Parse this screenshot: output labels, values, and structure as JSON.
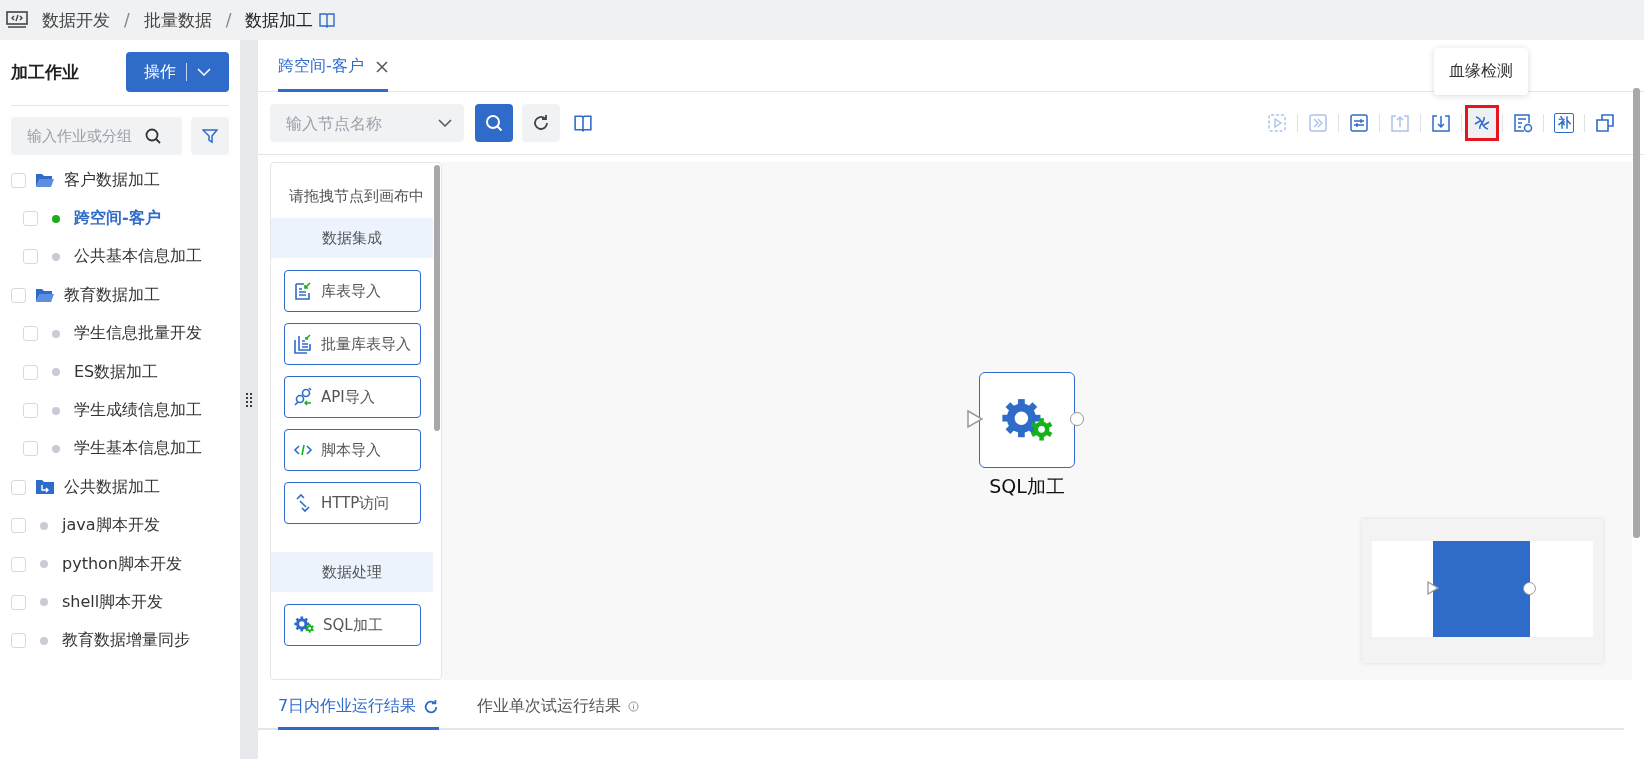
{
  "breadcrumb": {
    "items": [
      "数据开发",
      "批量数据",
      "数据加工"
    ],
    "separators": [
      "/",
      "/"
    ]
  },
  "sidebar": {
    "title": "加工作业",
    "action_button": "操作",
    "search": {
      "placeholder": "输入作业或分组"
    },
    "items": [
      {
        "kind": "folder",
        "label": "客户数据加工",
        "checked": false,
        "selected": false,
        "expanded": true,
        "children": [
          {
            "kind": "job",
            "label": "跨空间-客户",
            "checked": false,
            "selected": true,
            "color": "#1aad19"
          },
          {
            "kind": "job",
            "label": "公共基本信息加工",
            "checked": false,
            "selected": false,
            "color": "#c8ccd4"
          }
        ]
      },
      {
        "kind": "folder",
        "label": "教育数据加工",
        "checked": false,
        "selected": false,
        "expanded": true,
        "children": [
          {
            "kind": "job",
            "label": "学生信息批量开发",
            "checked": false,
            "selected": false,
            "color": "#c8ccd4"
          },
          {
            "kind": "job",
            "label": "ES数据加工",
            "checked": false,
            "selected": false,
            "color": "#c8ccd4"
          },
          {
            "kind": "job",
            "label": "学生成绩信息加工",
            "checked": false,
            "selected": false,
            "color": "#c8ccd4"
          },
          {
            "kind": "job",
            "label": "学生基本信息加工",
            "checked": false,
            "selected": false,
            "color": "#c8ccd4"
          }
        ]
      },
      {
        "kind": "folder",
        "label": "公共数据加工",
        "checked": false,
        "selected": false,
        "expanded": false
      },
      {
        "kind": "job",
        "label": "java脚本开发",
        "checked": false,
        "selected": false,
        "color": "#c8ccd4"
      },
      {
        "kind": "job",
        "label": "python脚本开发",
        "checked": false,
        "selected": false,
        "color": "#c8ccd4"
      },
      {
        "kind": "job",
        "label": "shell脚本开发",
        "checked": false,
        "selected": false,
        "color": "#c8ccd4"
      },
      {
        "kind": "job",
        "label": "教育数据增量同步",
        "checked": false,
        "selected": false,
        "color": "#c8ccd4"
      }
    ]
  },
  "tabs": [
    {
      "label": "跨空间-客户",
      "selected": true
    }
  ],
  "toolbar": {
    "node_search": {
      "placeholder": "输入节点名称"
    },
    "tools": [
      {
        "kind": "run-box",
        "disabled": true,
        "selected": false
      },
      {
        "kind": "fast-forward",
        "disabled": true,
        "selected": false
      },
      {
        "kind": "sliders",
        "disabled": false,
        "selected": false
      },
      {
        "kind": "upload",
        "disabled": true,
        "selected": false
      },
      {
        "kind": "download",
        "disabled": false,
        "selected": false
      },
      {
        "kind": "helix",
        "disabled": false,
        "selected": true,
        "tooltip": "血缘检测"
      },
      {
        "kind": "doc-gear",
        "disabled": false,
        "selected": false
      },
      {
        "kind": "glyph",
        "glyph": "补",
        "disabled": false,
        "selected": false
      },
      {
        "kind": "copy",
        "disabled": false,
        "selected": false
      }
    ]
  },
  "palette": {
    "hint": "请拖拽节点到画布中",
    "sections": [
      {
        "title": "数据集成",
        "nodes": [
          {
            "kind": "table-import",
            "label": "库表导入"
          },
          {
            "kind": "batch-import",
            "label": "批量库表导入"
          },
          {
            "kind": "api",
            "label": "API导入"
          },
          {
            "kind": "script",
            "label": "脚本导入"
          },
          {
            "kind": "http",
            "label": "HTTP访问"
          }
        ]
      },
      {
        "title": "数据处理",
        "nodes": [
          {
            "kind": "sql",
            "label": "SQL加工"
          }
        ]
      }
    ]
  },
  "canvas": {
    "nodes": [
      {
        "kind": "sql",
        "label": "SQL加工"
      }
    ]
  },
  "bottom_tabs": [
    {
      "label": "7日内作业运行结果",
      "selected": true,
      "kind": "refresh"
    },
    {
      "label": "作业单次试运行结果",
      "selected": false,
      "kind": "info"
    }
  ]
}
